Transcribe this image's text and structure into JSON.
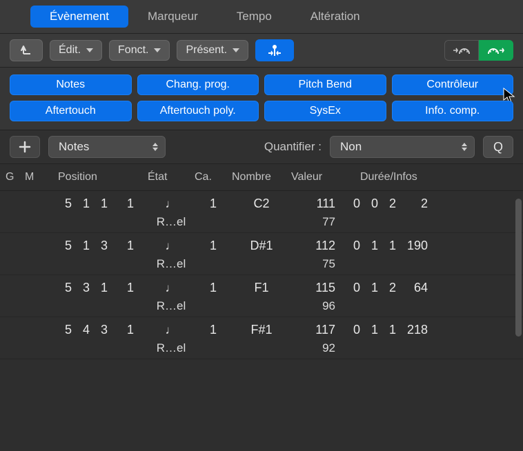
{
  "tabs": {
    "event": "Évènement",
    "marker": "Marqueur",
    "tempo": "Tempo",
    "alter": "Altération"
  },
  "toolbar": {
    "edit": "Édit.",
    "funct": "Fonct.",
    "present": "Présent."
  },
  "filters": {
    "notes": "Notes",
    "progchange": "Chang. prog.",
    "pitchbend": "Pitch Bend",
    "controller": "Contrôleur",
    "aftertouch": "Aftertouch",
    "polyafter": "Aftertouch poly.",
    "sysex": "SysEx",
    "metainfo": "Info. comp."
  },
  "controls": {
    "type_select": "Notes",
    "quantize_label": "Quantifier :",
    "quantize_value": "Non",
    "q_button": "Q"
  },
  "columns": {
    "g": "G",
    "m": "M",
    "pos": "Position",
    "etat": "État",
    "ca": "Ca.",
    "nombre": "Nombre",
    "valeur": "Valeur",
    "duree": "Durée/Infos"
  },
  "note_glyph": "♩",
  "rel_label": "R…el",
  "rows": [
    {
      "pos": [
        "5",
        "1",
        "1",
        "1"
      ],
      "ca": "1",
      "nombre": "C2",
      "valeur": "111",
      "duree": [
        "0",
        "0",
        "2",
        "2"
      ],
      "rel_val": "77"
    },
    {
      "pos": [
        "5",
        "1",
        "3",
        "1"
      ],
      "ca": "1",
      "nombre": "D#1",
      "valeur": "112",
      "duree": [
        "0",
        "1",
        "1",
        "190"
      ],
      "rel_val": "75"
    },
    {
      "pos": [
        "5",
        "3",
        "1",
        "1"
      ],
      "ca": "1",
      "nombre": "F1",
      "valeur": "115",
      "duree": [
        "0",
        "1",
        "2",
        "64"
      ],
      "rel_val": "96"
    },
    {
      "pos": [
        "5",
        "4",
        "3",
        "1"
      ],
      "ca": "1",
      "nombre": "F#1",
      "valeur": "117",
      "duree": [
        "0",
        "1",
        "1",
        "218"
      ],
      "rel_val": "92"
    }
  ]
}
